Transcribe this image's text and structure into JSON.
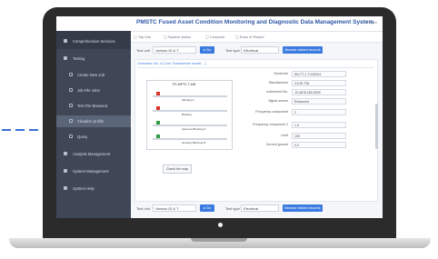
{
  "app": {
    "title": "PMSTC Fused Asset Condition Monitoring and Diagnostic Data Management System",
    "top_right": "▲ ✉  Ryan"
  },
  "tabs": [
    "▢ Top Info",
    "▢ System status",
    "▢ Compare",
    "▢ Ease of Report"
  ],
  "sidebar": {
    "items": [
      {
        "label": "Comprehensive Services",
        "kind": "top"
      },
      {
        "label": "Testing",
        "kind": "top"
      },
      {
        "label": "Create New Job",
        "kind": "sub"
      },
      {
        "label": "Job File Jobs",
        "kind": "sub"
      },
      {
        "label": "Test File Browsed",
        "kind": "sub"
      },
      {
        "label": "Visualize profile",
        "kind": "sub",
        "active": true
      },
      {
        "label": "Query",
        "kind": "sub"
      },
      {
        "label": "Analysis Management",
        "kind": "top"
      },
      {
        "label": "System Management",
        "kind": "top"
      },
      {
        "label": "System Help",
        "kind": "top"
      }
    ]
  },
  "toolbar": {
    "test_label": "Test unit",
    "test_value": "Various ID & T",
    "go_label": "▸ Go",
    "type_label": "Test type",
    "type_value": "Electrical",
    "action_label": "Browse related records"
  },
  "panel": {
    "heading": "Overview: No. 4 [ Line  Transformer model... ]",
    "diagram": {
      "title": "P2-MPTC T-6/B",
      "strips": [
        {
          "label": "Winding A",
          "mark": "red"
        },
        {
          "label": "Bushing",
          "mark": "red"
        },
        {
          "label": "Aperture Blocking A",
          "mark": "green"
        },
        {
          "label": "Housing Blocking B",
          "mark": "green"
        }
      ],
      "button": "Check the map"
    },
    "info_rows": [
      {
        "key": "Serial line",
        "value": "SN-TT-1-T-002024"
      },
      {
        "key": "Manufacturer",
        "value": "XJ/JS-T36"
      },
      {
        "key": "Instrument No.",
        "value": "J0-4678-180-0003"
      },
      {
        "key": "Signal source",
        "value": "Enhanced"
      },
      {
        "key": "Frequency component",
        "value": "2"
      },
      {
        "key": "Frequency component 2",
        "value": "1.0"
      },
      {
        "key": "Limit",
        "value": "100"
      },
      {
        "key": "Current ground",
        "value": "0.0"
      }
    ]
  },
  "bottom": {
    "test_label": "Test unit",
    "test_value": "Various ID & T",
    "go_label": "▸ Go",
    "type_label": "Test type",
    "type_value": "Electrical",
    "action_label": "Browse related records"
  }
}
